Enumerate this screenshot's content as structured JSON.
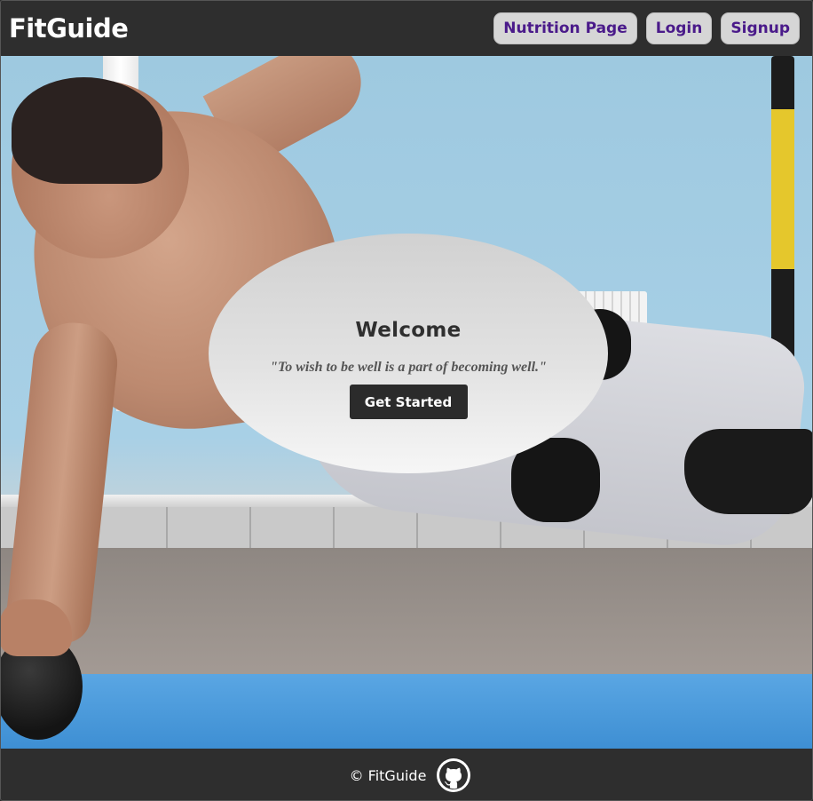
{
  "header": {
    "brand": "FitGuide",
    "nav": {
      "nutrition": "Nutrition Page",
      "login": "Login",
      "signup": "Signup"
    }
  },
  "hero": {
    "background_image": "person-doing-side-plank-on-medicine-ball",
    "welcome": {
      "title": "Welcome",
      "quote": "\"To wish to be well is a part of becoming well.\"",
      "button": "Get Started"
    }
  },
  "footer": {
    "copyright": "© FitGuide",
    "icon": "github-icon"
  },
  "colors": {
    "header_bg": "#2e2e2e",
    "nav_text": "#4a1a8a",
    "nav_bg": "#d6d6d6",
    "button_bg": "#2b2b2b"
  }
}
